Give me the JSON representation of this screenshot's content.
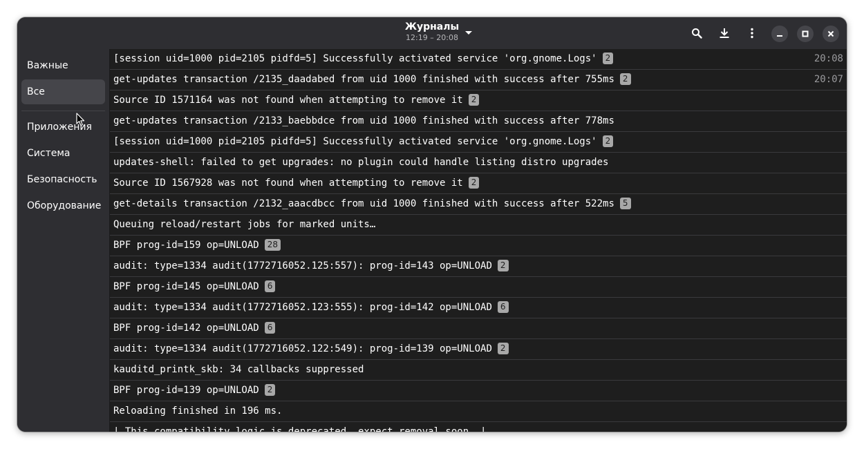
{
  "window": {
    "title": "Журналы",
    "subtitle": "12:19 – 20:08"
  },
  "header": {
    "icons": [
      "chevron-down-icon",
      "search-icon",
      "download-icon",
      "kebab-menu-icon",
      "minimize-icon",
      "maximize-icon",
      "close-icon"
    ]
  },
  "sidebar": {
    "items": [
      {
        "label": "Важные",
        "selected": false
      },
      {
        "label": "Все",
        "selected": true
      },
      {
        "label": "Приложения",
        "selected": false
      },
      {
        "label": "Система",
        "selected": false
      },
      {
        "label": "Безопасность",
        "selected": false
      },
      {
        "label": "Оборудование",
        "selected": false
      }
    ]
  },
  "log": {
    "rows": [
      {
        "message": "[session uid=1000 pid=2105 pidfd=5] Successfully activated service 'org.gnome.Logs'",
        "count": "2",
        "time": "20:08"
      },
      {
        "message": "get-updates transaction /2135_daadabed from uid 1000 finished with success after 755ms",
        "count": "2",
        "time": "20:07"
      },
      {
        "message": "Source ID 1571164 was not found when attempting to remove it",
        "count": "2",
        "time": ""
      },
      {
        "message": "get-updates transaction /2133_baebbdce from uid 1000 finished with success after 778ms",
        "count": "",
        "time": ""
      },
      {
        "message": "[session uid=1000 pid=2105 pidfd=5] Successfully activated service 'org.gnome.Logs'",
        "count": "2",
        "time": ""
      },
      {
        "message": "updates-shell: failed to get upgrades: no plugin could handle listing distro upgrades",
        "count": "",
        "time": ""
      },
      {
        "message": "Source ID 1567928 was not found when attempting to remove it",
        "count": "2",
        "time": ""
      },
      {
        "message": "get-details transaction /2132_aaacdbcc from uid 1000 finished with success after 522ms",
        "count": "5",
        "time": ""
      },
      {
        "message": "Queuing reload/restart jobs for marked units…",
        "count": "",
        "time": ""
      },
      {
        "message": "BPF prog-id=159 op=UNLOAD",
        "count": "28",
        "time": ""
      },
      {
        "message": "audit: type=1334 audit(1772716052.125:557): prog-id=143 op=UNLOAD",
        "count": "2",
        "time": ""
      },
      {
        "message": "BPF prog-id=145 op=UNLOAD",
        "count": "6",
        "time": ""
      },
      {
        "message": "audit: type=1334 audit(1772716052.123:555): prog-id=142 op=UNLOAD",
        "count": "6",
        "time": ""
      },
      {
        "message": "BPF prog-id=142 op=UNLOAD",
        "count": "6",
        "time": ""
      },
      {
        "message": "audit: type=1334 audit(1772716052.122:549): prog-id=139 op=UNLOAD",
        "count": "2",
        "time": ""
      },
      {
        "message": "kauditd_printk_skb: 34 callbacks suppressed",
        "count": "",
        "time": ""
      },
      {
        "message": "BPF prog-id=139 op=UNLOAD",
        "count": "2",
        "time": ""
      },
      {
        "message": "Reloading finished in 196 ms.",
        "count": "",
        "time": ""
      },
      {
        "message": "| This compatibility logic is deprecated, expect removal soon. |",
        "count": "",
        "time": ""
      }
    ]
  },
  "colors": {
    "window_bg": "#222226",
    "header_bg": "#2e2e32",
    "list_bg": "#1e1e1e",
    "badge_bg": "#a8a8a8",
    "selected_bg": "#45454a"
  }
}
